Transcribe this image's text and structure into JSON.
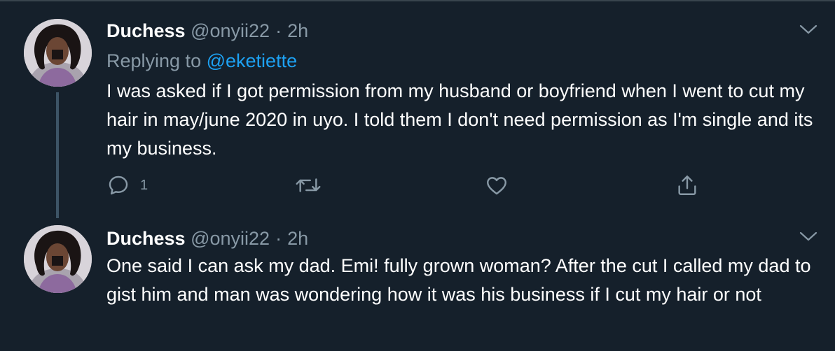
{
  "tweets": [
    {
      "name": "Duchess",
      "handle": "@onyii22",
      "separator": "·",
      "time": "2h",
      "replying_prefix": "Replying to",
      "replying_to": "@eketiette",
      "text": "I was asked if I got permission from my husband or boyfriend when I went to cut my hair in may/june 2020 in uyo. I told them I don't need permission as I'm single and its my business.",
      "reply_count": "1",
      "icons": [
        "reply-icon",
        "retweet-icon",
        "like-icon",
        "share-icon",
        "chevron-down-icon"
      ]
    },
    {
      "name": "Duchess",
      "handle": "@onyii22",
      "separator": "·",
      "time": "2h",
      "text": "One said I can ask my dad. Emi! fully grown woman? After the cut I called my dad to gist him and man was wondering how it was his business if I cut my hair or not",
      "icons": [
        "chevron-down-icon"
      ]
    }
  ],
  "colors": {
    "background": "#15202b",
    "text_primary": "#ffffff",
    "text_secondary": "#8899a6",
    "link": "#1da1f2",
    "thread_line": "#3d5466"
  }
}
